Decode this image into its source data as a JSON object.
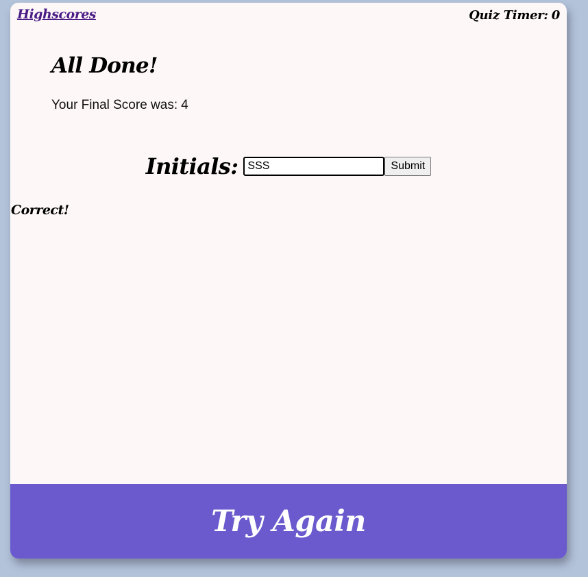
{
  "nav": {
    "highscores_label": "Highscores",
    "timer_label": "Quiz Timer:",
    "timer_value": "0"
  },
  "result": {
    "title": "All Done!",
    "score_label": "Your Final Score was:",
    "score_value": "4"
  },
  "form": {
    "initials_label": "Initials:",
    "initials_value": "SSS",
    "submit_label": "Submit"
  },
  "feedback": {
    "message": "Correct!"
  },
  "footer": {
    "try_again_label": "Try Again"
  },
  "colors": {
    "page_background": "#b3c3da",
    "card_background": "#fdf8f7",
    "footer_background": "#6a5acd",
    "link_color": "#4b1c86"
  }
}
